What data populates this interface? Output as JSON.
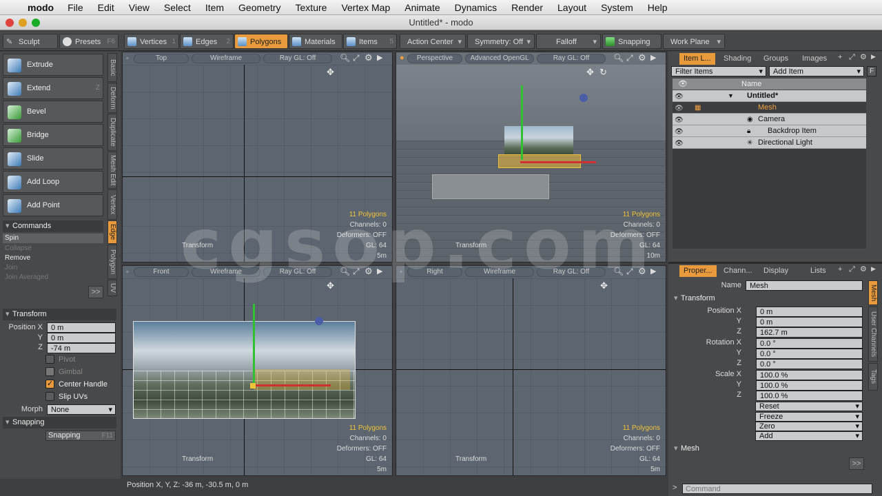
{
  "menubar": {
    "app_name": "modo",
    "items": [
      "File",
      "Edit",
      "View",
      "Select",
      "Item",
      "Geometry",
      "Texture",
      "Vertex Map",
      "Animate",
      "Dynamics",
      "Render",
      "Layout",
      "System",
      "Help"
    ]
  },
  "window": {
    "title": "Untitled* - modo"
  },
  "toolbar": {
    "sculpt": "Sculpt",
    "presets": "Presets",
    "presets_key": "F6",
    "vertices": "Vertices",
    "vertices_num": "1",
    "edges": "Edges",
    "edges_num": "2",
    "polygons": "Polygons",
    "materials": "Materials",
    "items": "Items",
    "items_num": "5",
    "action_center": "Action Center",
    "symmetry": "Symmetry: Off",
    "falloff": "Falloff",
    "snapping": "Snapping",
    "work_plane": "Work Plane"
  },
  "tools": [
    {
      "label": "Extrude",
      "key": ""
    },
    {
      "label": "Extend",
      "key": "Z"
    },
    {
      "label": "Bevel",
      "key": ""
    },
    {
      "label": "Bridge",
      "key": ""
    },
    {
      "label": "Slide",
      "key": ""
    },
    {
      "label": "Add Loop",
      "key": ""
    },
    {
      "label": "Add Point",
      "key": ""
    }
  ],
  "vertical_tabs": [
    "Basic",
    "Deform",
    "Duplicate",
    "Mesh Edit",
    "Vertex",
    "Edge",
    "Polygon",
    "UV"
  ],
  "commands": {
    "header": "Commands",
    "items": [
      "Spin",
      "Collapse",
      "Remove",
      "Join",
      "Join Averaged"
    ],
    "more": ">>"
  },
  "transform": {
    "header": "Transform",
    "pos_label": "Position X",
    "x": "0 m",
    "y": "0 m",
    "z": "-74 m",
    "pivot": "Pivot",
    "gimbal": "Gimbal",
    "center_handle": "Center Handle",
    "slip_uvs": "Slip UVs",
    "morph_label": "Morph",
    "morph_value": "None"
  },
  "snapping": {
    "header": "Snapping",
    "button": "Snapping",
    "key": "F11"
  },
  "viewports": [
    {
      "view": "Top",
      "shade": "Wireframe",
      "ray": "Ray GL: Off",
      "polys": "11 Polygons",
      "channels": "Channels: 0",
      "deformers": "Deformers: OFF",
      "gl": "GL: 64",
      "dist": "5m",
      "tool": "Transform"
    },
    {
      "view": "Perspective",
      "shade": "Advanced OpenGL",
      "ray": "Ray GL: Off",
      "polys": "11 Polygons",
      "channels": "Channels: 0",
      "deformers": "Deformers: OFF",
      "gl": "GL: 64",
      "dist": "10m",
      "tool": "Transform"
    },
    {
      "view": "Front",
      "shade": "Wireframe",
      "ray": "Ray GL: Off",
      "polys": "11 Polygons",
      "channels": "Channels: 0",
      "deformers": "Deformers: OFF",
      "gl": "GL: 64",
      "dist": "5m",
      "tool": "Transform"
    },
    {
      "view": "Right",
      "shade": "Wireframe",
      "ray": "Ray GL: Off",
      "polys": "11 Polygons",
      "channels": "Channels: 0",
      "deformers": "Deformers: OFF",
      "gl": "GL: 64",
      "dist": "5m",
      "tool": "Transform"
    }
  ],
  "item_list": {
    "tabs": [
      "Item L...",
      "Shading",
      "Groups",
      "Images"
    ],
    "filter": "Filter Items",
    "add_item": "Add Item",
    "col_name": "Name",
    "rows": [
      "Untitled*",
      "Mesh",
      "Camera",
      "Backdrop Item",
      "Directional Light"
    ]
  },
  "properties": {
    "tabs": [
      "Proper...",
      "Chann...",
      "Display",
      "Lists"
    ],
    "side_tabs": [
      "Mesh",
      "User Channels",
      "Tags"
    ],
    "name_label": "Name",
    "name_value": "Mesh",
    "transform_header": "Transform",
    "position_label": "Position X",
    "pos": [
      "0 m",
      "0 m",
      "162.7 m"
    ],
    "rotation_label": "Rotation X",
    "rot": [
      "0.0 °",
      "0.0 °",
      "0.0 °"
    ],
    "scale_label": "Scale X",
    "scale": [
      "100.0 %",
      "100.0 %",
      "100.0 %"
    ],
    "y": "Y",
    "z": "Z",
    "buttons": [
      "Reset",
      "Freeze",
      "Zero",
      "Add"
    ],
    "mesh_header": "Mesh",
    "more": ">>"
  },
  "status": {
    "text": "Position X, Y, Z:   -36 m, -30.5 m, 0 m"
  },
  "command_field": {
    "placeholder": "Command"
  },
  "watermark": "cgsop.com"
}
